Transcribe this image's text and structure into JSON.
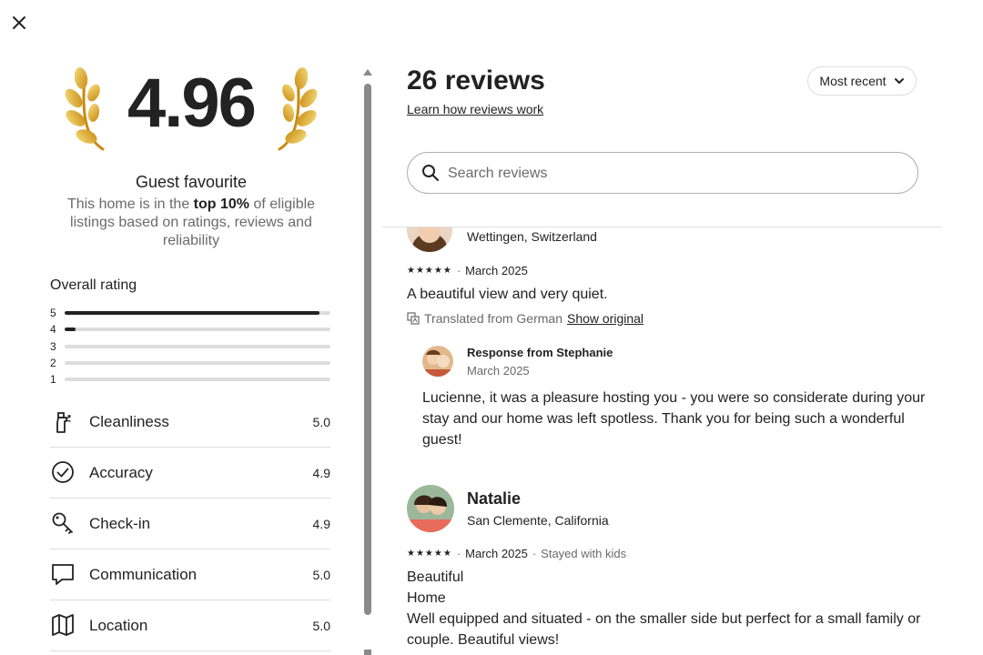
{
  "close_label": "Close",
  "summary": {
    "overall_score": "4.96",
    "badge_title": "Guest favourite",
    "desc_pre": "This home is in the ",
    "desc_bold": "top 10%",
    "desc_post": " of eligible listings based on ratings, reviews and reliability",
    "overall_title": "Overall rating",
    "distribution": [
      {
        "star": "5",
        "fraction": 0.96
      },
      {
        "star": "4",
        "fraction": 0.04
      },
      {
        "star": "3",
        "fraction": 0
      },
      {
        "star": "2",
        "fraction": 0
      },
      {
        "star": "1",
        "fraction": 0
      }
    ],
    "categories": [
      {
        "icon": "spray-bottle-icon",
        "label": "Cleanliness",
        "score": "5.0"
      },
      {
        "icon": "check-circle-icon",
        "label": "Accuracy",
        "score": "4.9"
      },
      {
        "icon": "key-icon",
        "label": "Check-in",
        "score": "4.9"
      },
      {
        "icon": "speech-bubble-icon",
        "label": "Communication",
        "score": "5.0"
      },
      {
        "icon": "map-icon",
        "label": "Location",
        "score": "5.0"
      }
    ]
  },
  "reviews_panel": {
    "title": "26 reviews",
    "learn_link": "Learn how reviews work",
    "sort_label": "Most recent",
    "search_placeholder": "Search reviews",
    "reviews": [
      {
        "location": "Wettingen, Switzerland",
        "stars": "★★★★★",
        "date": "March 2025",
        "text": "A beautiful view and very quiet.",
        "translated_note": "Translated from German",
        "show_original": "Show original",
        "response_from": "Response from Stephanie",
        "response_date": "March 2025",
        "response_text": "Lucienne, it was a pleasure hosting you - you were so considerate during your stay and our home was left spotless. Thank you for being such a wonderful guest!"
      },
      {
        "name": "Natalie",
        "location": "San Clemente, California",
        "stars": "★★★★★",
        "date": "March 2025",
        "extra": "Stayed with kids",
        "line1": "Beautiful",
        "line2": "Home",
        "line3": "Well equipped and situated - on the smaller side but perfect for a small family or couple. Beautiful views!"
      }
    ]
  }
}
